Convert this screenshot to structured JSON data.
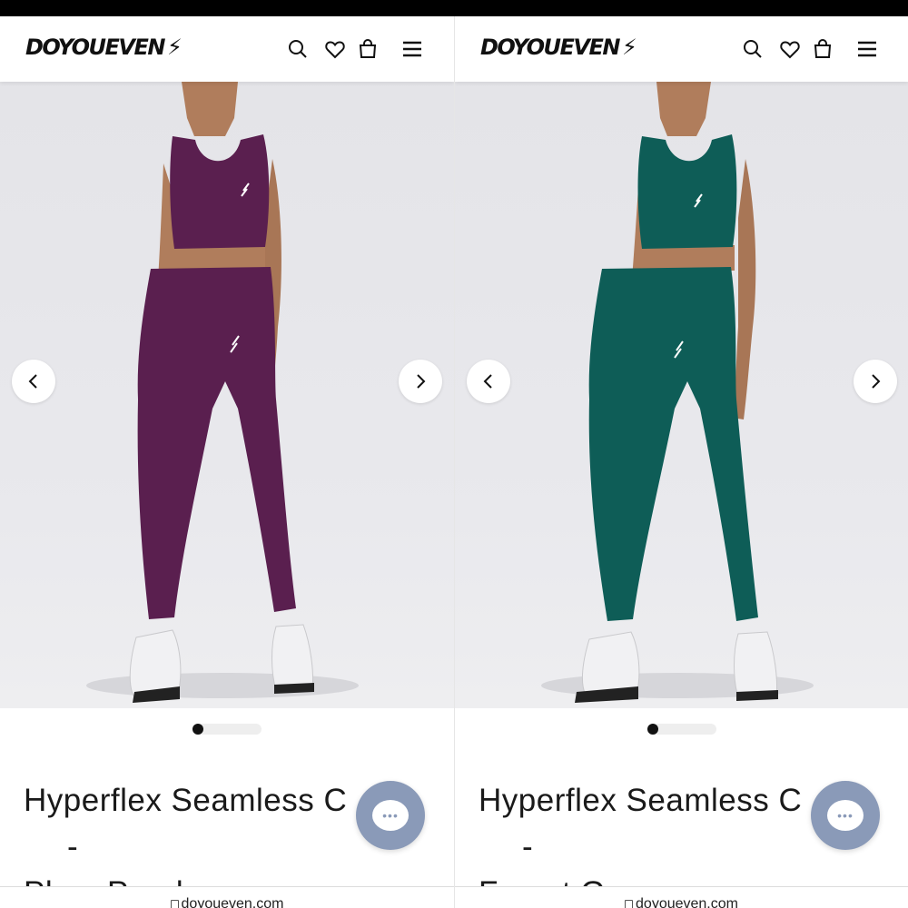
{
  "panels": [
    {
      "brand": "DOYOUEVEN",
      "product_title_line1": "Hyperflex Seamless C",
      "product_title_line2": "Plum Purple",
      "title_suffix": "-",
      "outfit_color": "#5a1f4f",
      "url": "doyoueven.com",
      "gallery": {
        "current": 1,
        "total": 6
      }
    },
    {
      "brand": "DOYOUEVEN",
      "product_title_line1": "Hyperflex Seamless C",
      "product_title_line2": "Forest Green",
      "title_suffix": "-",
      "outfit_color": "#0e5d57",
      "url": "doyoueven.com",
      "gallery": {
        "current": 1,
        "total": 6
      }
    }
  ],
  "icons": {
    "search": "search-icon",
    "wishlist": "heart-icon",
    "bag": "shopping-bag-icon",
    "menu": "hamburger-menu-icon",
    "prev": "chevron-left-icon",
    "next": "chevron-right-icon",
    "chat": "chat-icon"
  },
  "colors": {
    "topbar": "#000000",
    "chat_button": "#8a9ab8",
    "image_bg": "#e6e6ea"
  }
}
